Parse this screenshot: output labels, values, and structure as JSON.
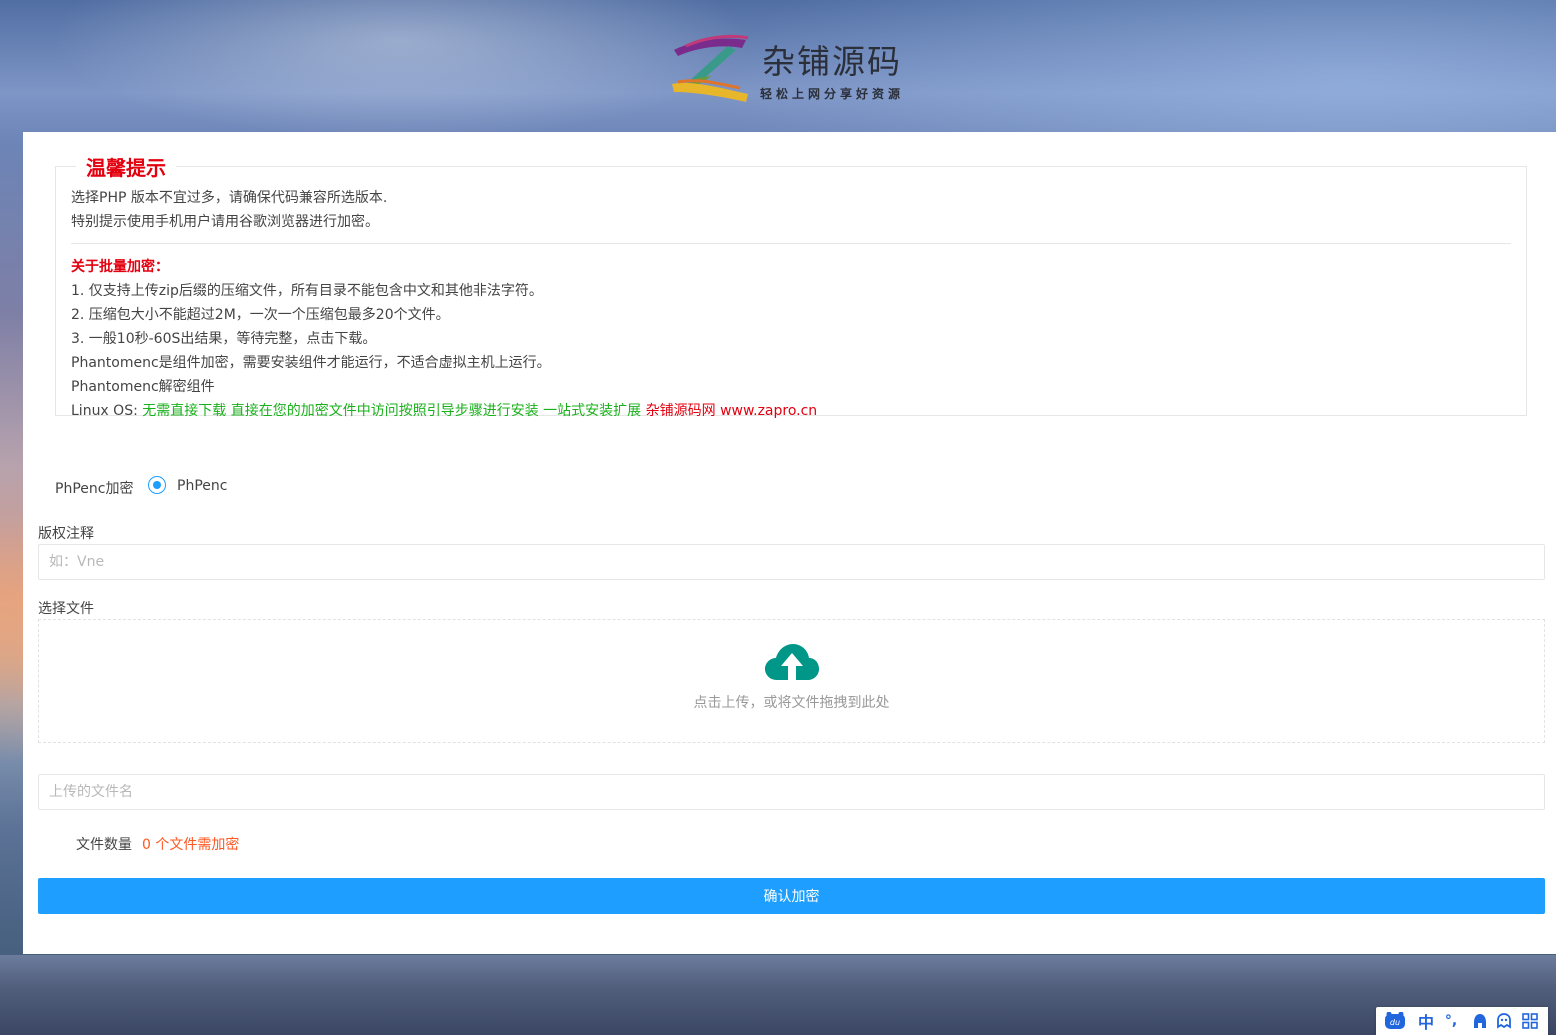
{
  "header": {
    "logo_title": "杂铺源码",
    "logo_slogan": "轻松上网分享好资源"
  },
  "tips": {
    "legend": "温馨提示",
    "line1": "选择PHP 版本不宜过多，请确保代码兼容所选版本.",
    "line2": "特别提示使用手机用户请用谷歌浏览器进行加密。",
    "batch_title": "关于批量加密：",
    "item1": "1. 仅支持上传zip后缀的压缩文件，所有目录不能包含中文和其他非法字符。",
    "item2": "2. 压缩包大小不能超过2M，一次一个压缩包最多20个文件。",
    "item3": "3. 一般10秒-60S出结果，等待完整，点击下载。",
    "note1": "Phantomenc是组件加密，需要安装组件才能运行，不适合虚拟主机上运行。",
    "note2": "Phantomenc解密组件",
    "linux_label": "Linux OS: ",
    "linux_link1": "无需直接下载",
    "linux_link2": "直接在您的加密文件中访问按照引导步骤进行安装",
    "linux_link3": "一站式安装扩展",
    "site_name": "杂铺源码网",
    "site_url": "www.zapro.cn"
  },
  "form": {
    "encrypt_label": "PhPenc加密",
    "encrypt_option": "PhPenc",
    "copyright_label": "版权注释",
    "copyright_placeholder": "如：Vne",
    "file_label": "选择文件",
    "upload_text": "点击上传，或将文件拖拽到此处",
    "filename_placeholder": "上传的文件名",
    "count_label": "文件数量",
    "count_value": "0 个文件需加密",
    "submit_label": "确认加密"
  },
  "ime": {
    "mode": "中",
    "punct": "°,",
    "icons": [
      "du-paw-icon",
      "chinese-mode-icon",
      "punctuation-icon",
      "keyboard-icon",
      "skin-icon",
      "grid-menu-icon"
    ]
  },
  "colors": {
    "accent": "#1e9fff",
    "warning_red": "#e3000f",
    "link_green": "#19b01b",
    "count_orange": "#ff5722",
    "upload_icon": "#009688"
  }
}
